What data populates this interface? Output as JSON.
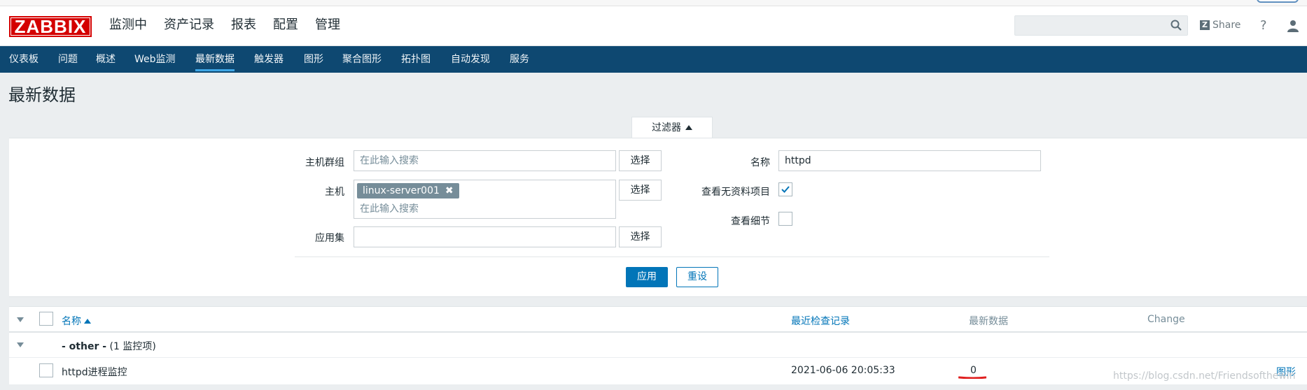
{
  "header": {
    "logo": "ZABBIX",
    "main_nav": [
      {
        "label": "监测中",
        "active": true
      },
      {
        "label": "资产记录"
      },
      {
        "label": "报表"
      },
      {
        "label": "配置"
      },
      {
        "label": "管理"
      }
    ],
    "share_label": "Share",
    "help_label": "?"
  },
  "sub_nav": [
    {
      "label": "仪表板"
    },
    {
      "label": "问题"
    },
    {
      "label": "概述"
    },
    {
      "label": "Web监测"
    },
    {
      "label": "最新数据",
      "active": true
    },
    {
      "label": "触发器"
    },
    {
      "label": "图形"
    },
    {
      "label": "聚合图形"
    },
    {
      "label": "拓扑图"
    },
    {
      "label": "自动发现"
    },
    {
      "label": "服务"
    }
  ],
  "page": {
    "title": "最新数据"
  },
  "filter": {
    "tab_label": "过滤器",
    "host_group_label": "主机群组",
    "host_group_placeholder": "在此输入搜索",
    "host_label": "主机",
    "host_tag": "linux-server001",
    "host_placeholder": "在此输入搜索",
    "app_label": "应用集",
    "app_value": "",
    "select_label": "选择",
    "name_label": "名称",
    "name_value": "httpd",
    "show_items_without_data_label": "查看无资料项目",
    "show_items_without_data_checked": true,
    "show_details_label": "查看细节",
    "show_details_checked": false,
    "apply_label": "应用",
    "reset_label": "重设"
  },
  "table": {
    "columns": {
      "name": "名称",
      "last_check": "最近检查记录",
      "last_value": "最新数据",
      "change": "Change"
    },
    "groups": [
      {
        "name": "- other -",
        "count_label": "(1 监控项)",
        "items": [
          {
            "name": "httpd进程监控",
            "last_check": "2021-06-06 20:05:33",
            "last_value": "0",
            "change": "",
            "action": "图形"
          }
        ]
      }
    ]
  },
  "watermark": "https://blog.csdn.net/Friendsofthewin",
  "colors": {
    "brand_red": "#d40000",
    "nav_blue": "#0e4871",
    "link_blue": "#0275b8",
    "annotation_red": "#e02020"
  }
}
